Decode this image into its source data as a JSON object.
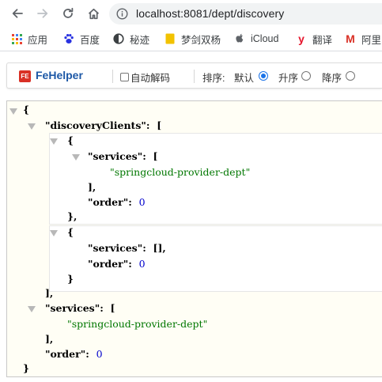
{
  "browser": {
    "url": "localhost:8081/dept/discovery"
  },
  "bookmarks": [
    {
      "label": "应用",
      "icon": "apps-grid-icon",
      "color": "#4285f4"
    },
    {
      "label": "百度",
      "icon": "baidu-paw-icon",
      "color": "#2932e1"
    },
    {
      "label": "秘迹",
      "icon": "mijisou-icon",
      "color": "#3c4043"
    },
    {
      "label": "梦剑双杨",
      "icon": "folder-icon",
      "color": "#f2c200"
    },
    {
      "label": "iCloud",
      "icon": "apple-icon",
      "color": "#5f6368"
    },
    {
      "label": "翻译",
      "icon": "youdao-y-icon",
      "color": "#e6162d"
    },
    {
      "label": "阿里",
      "icon": "gmail-m-icon",
      "color": "#d93025"
    }
  ],
  "fehelper": {
    "title": "FeHelper",
    "auto_decode_label": "自动解码",
    "sort_label": "排序:",
    "sort_options": [
      {
        "label": "默认",
        "selected": true
      },
      {
        "label": "升序",
        "selected": false
      },
      {
        "label": "降序",
        "selected": false
      }
    ]
  },
  "json_view": {
    "keys": {
      "discoveryClients": "\"discoveryClients\"",
      "services": "\"services\"",
      "order": "\"order\""
    },
    "values": {
      "provider": "\"springcloud-provider-dept\"",
      "order_client1": "0",
      "order_client2": "0",
      "order_root": "0"
    }
  }
}
